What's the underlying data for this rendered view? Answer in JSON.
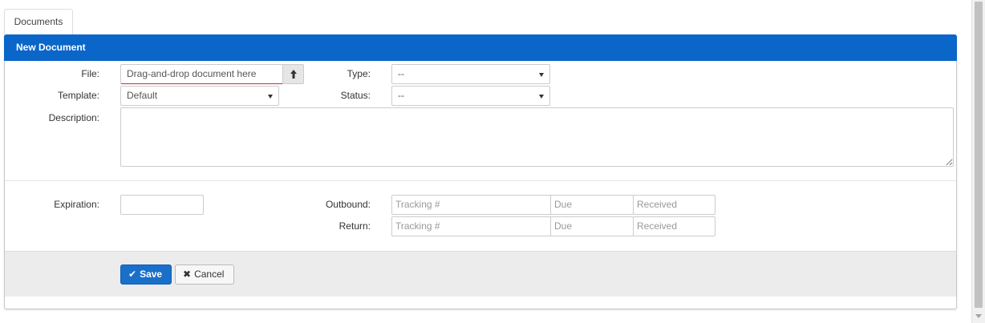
{
  "tabs": [
    {
      "label": "Documents"
    }
  ],
  "panel": {
    "title": "New Document"
  },
  "form": {
    "file": {
      "label": "File:",
      "value": "Drag-and-drop document here",
      "upload_icon": "arrow-up-icon"
    },
    "template": {
      "label": "Template:",
      "value": "Default"
    },
    "type": {
      "label": "Type:",
      "value": "--"
    },
    "status": {
      "label": "Status:",
      "value": "--"
    },
    "description": {
      "label": "Description:",
      "value": ""
    },
    "expiration": {
      "label": "Expiration:",
      "value": ""
    },
    "outbound": {
      "label": "Outbound:",
      "tracking_placeholder": "Tracking #",
      "due_placeholder": "Due",
      "received_placeholder": "Received"
    },
    "return": {
      "label": "Return:",
      "tracking_placeholder": "Tracking #",
      "due_placeholder": "Due",
      "received_placeholder": "Received"
    }
  },
  "actions": {
    "save": {
      "label": "Save",
      "icon": "check-icon"
    },
    "cancel": {
      "label": "Cancel",
      "icon": "x-icon"
    }
  },
  "colors": {
    "header": "#0a66c8",
    "primary_button": "#1a6fc9",
    "footer_bg": "#ececec"
  }
}
